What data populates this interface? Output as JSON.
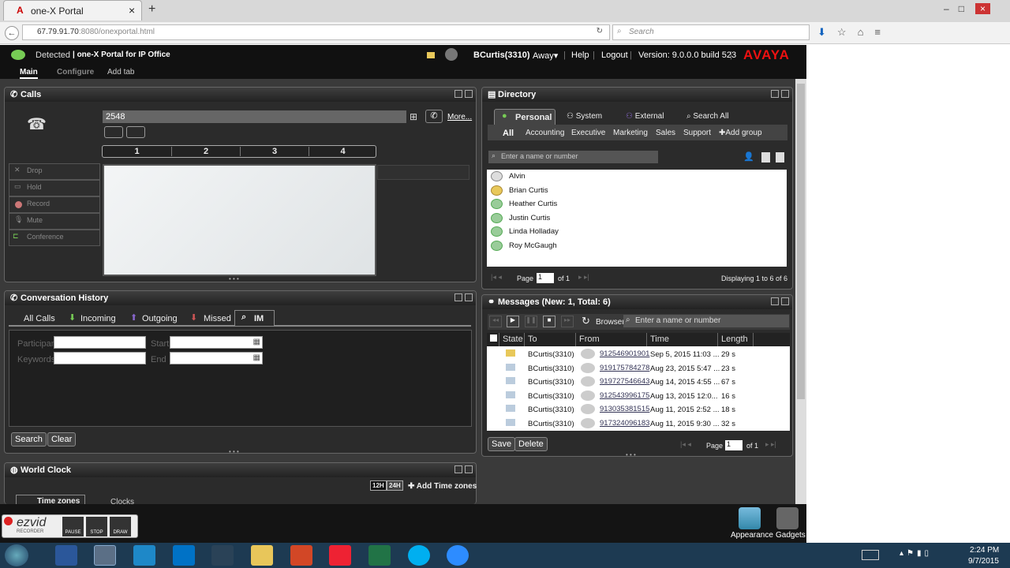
{
  "browser": {
    "tab_title": "one-X Portal",
    "url_host": "67.79.91.70",
    "url_path": ":8080/onexportal.html",
    "search_placeholder": "Search",
    "new_tab": "+",
    "close": "×"
  },
  "header": {
    "detected": "Detected",
    "product": "| one-X Portal for IP Office",
    "user": "BCurtis(3310)",
    "away": "Away▾",
    "help": "Help",
    "logout": "Logout",
    "version": "Version: 9.0.0.0 build 523",
    "brand": "AVAYA",
    "sep": "|"
  },
  "nav": {
    "main": "Main",
    "configure": "Configure",
    "add_tab": "Add tab"
  },
  "calls": {
    "title": "Calls",
    "number": "2548",
    "more": "More...",
    "lines": [
      "1",
      "2",
      "3",
      "4"
    ],
    "buttons": [
      "Drop",
      "Hold",
      "Record",
      "Mute",
      "Conference"
    ]
  },
  "history": {
    "title": "Conversation History",
    "tabs": [
      "All Calls",
      "Incoming",
      "Outgoing",
      "Missed",
      "IM"
    ],
    "participant": "Participant",
    "start": "Start",
    "keywords": "Keywords",
    "end": "End",
    "search": "Search",
    "clear": "Clear"
  },
  "worldclock": {
    "title": "World Clock",
    "h12": "12H",
    "h24": "24H",
    "add": "Add Time zones",
    "tab_tz": "Time zones",
    "tab_clocks": "Clocks"
  },
  "directory": {
    "title": "Directory",
    "tabs": [
      "Personal",
      "System",
      "External",
      "Search All"
    ],
    "groups": [
      "All",
      "Accounting",
      "Executive",
      "Marketing",
      "Sales",
      "Support",
      "Add group"
    ],
    "search_placeholder": "Enter a name or number",
    "contacts": [
      "Alvin",
      "Brian Curtis",
      "Heather Curtis",
      "Justin Curtis",
      "Linda Holladay",
      "Roy McGaugh"
    ],
    "page_label": "Page",
    "page": "1",
    "of": "of 1",
    "displaying": "Displaying 1 to 6 of 6"
  },
  "messages": {
    "title": "Messages (New: 1, Total: 6)",
    "browser": "Browser",
    "search_placeholder": "Enter a name or number",
    "columns": [
      "State",
      "To",
      "From",
      "Time",
      "Length"
    ],
    "rows": [
      {
        "to": "BCurtis(3310)",
        "from": "912546901901",
        "time": "Sep 5, 2015 11:03 ...",
        "length": "29 s"
      },
      {
        "to": "BCurtis(3310)",
        "from": "919175784278",
        "time": "Aug 23, 2015 5:47 ...",
        "length": "23 s"
      },
      {
        "to": "BCurtis(3310)",
        "from": "919727546643",
        "time": "Aug 14, 2015 4:55 ...",
        "length": "67 s"
      },
      {
        "to": "BCurtis(3310)",
        "from": "912543996175",
        "time": "Aug 13, 2015 12:0...",
        "length": "16 s"
      },
      {
        "to": "BCurtis(3310)",
        "from": "913035381515",
        "time": "Aug 11, 2015 2:52 ...",
        "length": "18 s"
      },
      {
        "to": "BCurtis(3310)",
        "from": "917324096183",
        "time": "Aug 11, 2015 9:30 ...",
        "length": "32 s"
      }
    ],
    "save": "Save",
    "delete": "Delete",
    "page_label": "Page",
    "page": "1",
    "of": "of 1"
  },
  "bottom": {
    "appearance": "Appearance",
    "gadgets": "Gadgets"
  },
  "ezvid": {
    "brand": "ezvid",
    "sub": "RECORDER",
    "pause": "PAUSE",
    "stop": "STOP",
    "draw": "DRAW"
  },
  "taskbar": {
    "time": "2:24 PM",
    "date": "9/7/2015"
  }
}
